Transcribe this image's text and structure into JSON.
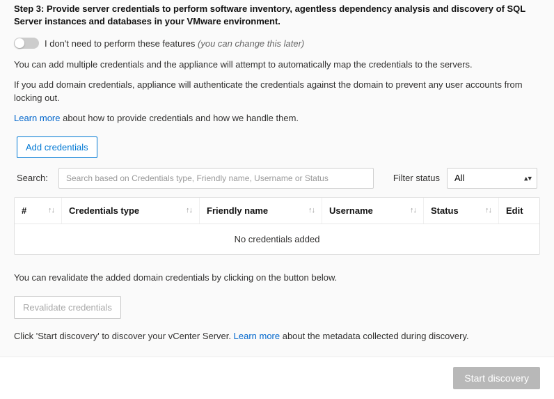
{
  "step": {
    "title": "Step 3: Provide server credentials to perform software inventory, agentless dependency analysis and discovery of SQL Server instances and databases in your VMware environment."
  },
  "toggle": {
    "label_main": "I don't need to perform these features",
    "label_hint": "(you can change this later)"
  },
  "paragraphs": {
    "p1": "You can add multiple credentials and the appliance will attempt to automatically map the credentials to the servers.",
    "p2": "If you add domain credentials, appliance will authenticate the credentials against  the domain to prevent any user accounts from locking out.",
    "learn_more_link": "Learn more",
    "learn_more_rest": " about how to provide credentials and how we handle them."
  },
  "buttons": {
    "add_credentials": "Add credentials",
    "revalidate": "Revalidate credentials",
    "start_discovery": "Start discovery"
  },
  "search": {
    "label": "Search:",
    "placeholder": "Search based on Credentials type, Friendly name, Username or Status"
  },
  "filter": {
    "label": "Filter status",
    "selected": "All"
  },
  "table": {
    "headers": {
      "num": "#",
      "type": "Credentials type",
      "name": "Friendly name",
      "user": "Username",
      "status": "Status",
      "edit": "Edit"
    },
    "empty": "No credentials added"
  },
  "revalidate_hint": "You can revalidate the added domain credentials by clicking on the button below.",
  "discovery": {
    "pre": "Click 'Start discovery' to discover your vCenter Server. ",
    "learn": "Learn more",
    "post": " about the metadata collected during discovery."
  }
}
